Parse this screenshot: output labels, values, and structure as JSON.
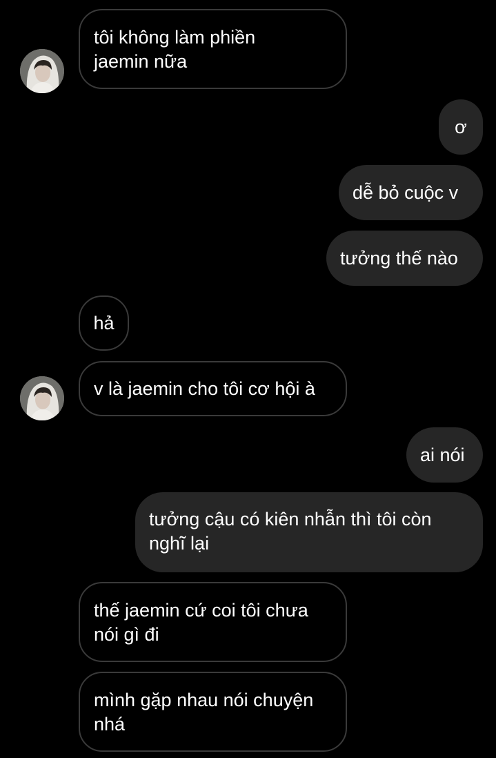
{
  "messages": [
    {
      "id": "m1",
      "from": "them",
      "lines": [
        "tôi không làm phiền",
        "jaemin nữa"
      ],
      "avatar": true
    },
    {
      "id": "m2",
      "from": "me",
      "text": "ơ"
    },
    {
      "id": "m3",
      "from": "me",
      "text": "dễ bỏ cuộc v"
    },
    {
      "id": "m4",
      "from": "me",
      "text": "tưởng thế nào"
    },
    {
      "id": "m5",
      "from": "them",
      "text": "hả"
    },
    {
      "id": "m6",
      "from": "them",
      "text": "v là jaemin cho tôi cơ hội à",
      "avatar": true
    },
    {
      "id": "m7",
      "from": "me",
      "text": "ai nói"
    },
    {
      "id": "m8",
      "from": "me",
      "lines": [
        "tưởng cậu có kiên nhẫn thì tôi còn",
        "nghĩ lại"
      ]
    },
    {
      "id": "m9",
      "from": "them",
      "lines": [
        "thế jaemin cứ coi tôi chưa",
        "nói gì đi"
      ]
    },
    {
      "id": "m10",
      "from": "them",
      "lines": [
        "mình gặp nhau nói chuyện",
        "nhá"
      ]
    }
  ],
  "colors": {
    "background": "#000000",
    "outgoing_bubble": "#262626",
    "incoming_border": "#3a3a3a",
    "text": "#ffffff"
  },
  "icons": {
    "avatar": "contact-avatar-hooded-person"
  }
}
